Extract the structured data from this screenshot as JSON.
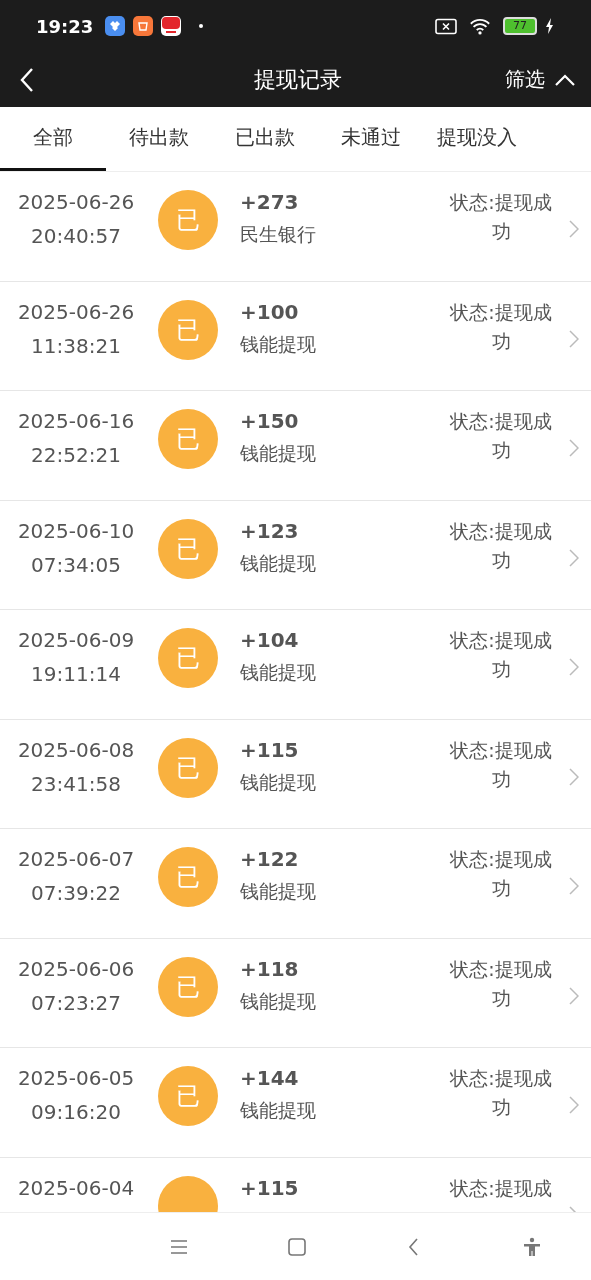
{
  "status_bar": {
    "time": "19:23",
    "battery": "77"
  },
  "header": {
    "title": "提现记录",
    "filter": "筛选"
  },
  "tabs": [
    {
      "label": "全部",
      "selected": true
    },
    {
      "label": "待出款",
      "selected": false
    },
    {
      "label": "已出款",
      "selected": false
    },
    {
      "label": "未通过",
      "selected": false
    },
    {
      "label": "提现没入",
      "selected": false
    }
  ],
  "records": [
    {
      "date": "2025-06-26",
      "time": "20:40:57",
      "badge": "已",
      "amount": "+273",
      "method": "民生银行",
      "status": "状态:提现成功"
    },
    {
      "date": "2025-06-26",
      "time": "11:38:21",
      "badge": "已",
      "amount": "+100",
      "method": "钱能提现",
      "status": "状态:提现成功"
    },
    {
      "date": "2025-06-16",
      "time": "22:52:21",
      "badge": "已",
      "amount": "+150",
      "method": "钱能提现",
      "status": "状态:提现成功"
    },
    {
      "date": "2025-06-10",
      "time": "07:34:05",
      "badge": "已",
      "amount": "+123",
      "method": "钱能提现",
      "status": "状态:提现成功"
    },
    {
      "date": "2025-06-09",
      "time": "19:11:14",
      "badge": "已",
      "amount": "+104",
      "method": "钱能提现",
      "status": "状态:提现成功"
    },
    {
      "date": "2025-06-08",
      "time": "23:41:58",
      "badge": "已",
      "amount": "+115",
      "method": "钱能提现",
      "status": "状态:提现成功"
    },
    {
      "date": "2025-06-07",
      "time": "07:39:22",
      "badge": "已",
      "amount": "+122",
      "method": "钱能提现",
      "status": "状态:提现成功"
    },
    {
      "date": "2025-06-06",
      "time": "07:23:27",
      "badge": "已",
      "amount": "+118",
      "method": "钱能提现",
      "status": "状态:提现成功"
    },
    {
      "date": "2025-06-05",
      "time": "09:16:20",
      "badge": "已",
      "amount": "+144",
      "method": "钱能提现",
      "status": "状态:提现成功"
    },
    {
      "date": "2025-06-04",
      "amount": "+115",
      "status": "状态:提现成"
    }
  ]
}
